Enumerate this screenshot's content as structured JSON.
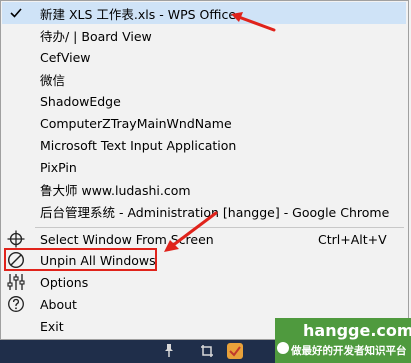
{
  "menu": {
    "windows": [
      {
        "label": "新建 XLS 工作表.xls - WPS Office",
        "checked": true
      },
      {
        "label": "待办/ | Board View"
      },
      {
        "label": "CefView"
      },
      {
        "label": "微信"
      },
      {
        "label": "ShadowEdge"
      },
      {
        "label": "ComputerZTrayMainWndName"
      },
      {
        "label": "Microsoft Text Input Application"
      },
      {
        "label": "PixPin"
      },
      {
        "label": "鲁大师 www.ludashi.com"
      },
      {
        "label": "后台管理系统 - Administration [hangge] - Google Chrome"
      }
    ],
    "select_window": {
      "label": "Select Window From Screen",
      "shortcut": "Ctrl+Alt+V",
      "icon": "crosshair-icon"
    },
    "unpin_all": {
      "label": "Unpin All Windows",
      "icon": "no-sign-icon"
    },
    "options": {
      "label": "Options",
      "icon": "sliders-icon"
    },
    "about": {
      "label": "About",
      "icon": "question-circle-icon"
    },
    "exit": {
      "label": "Exit"
    }
  },
  "watermark": {
    "domain": "hangge.com",
    "slogan": "做最好的开发者知识平台"
  },
  "colors": {
    "annotation": "#e0231b",
    "highlight": "#cfe3f7",
    "brand": "#4f9a3e",
    "taskbar": "#1f2e4a"
  }
}
